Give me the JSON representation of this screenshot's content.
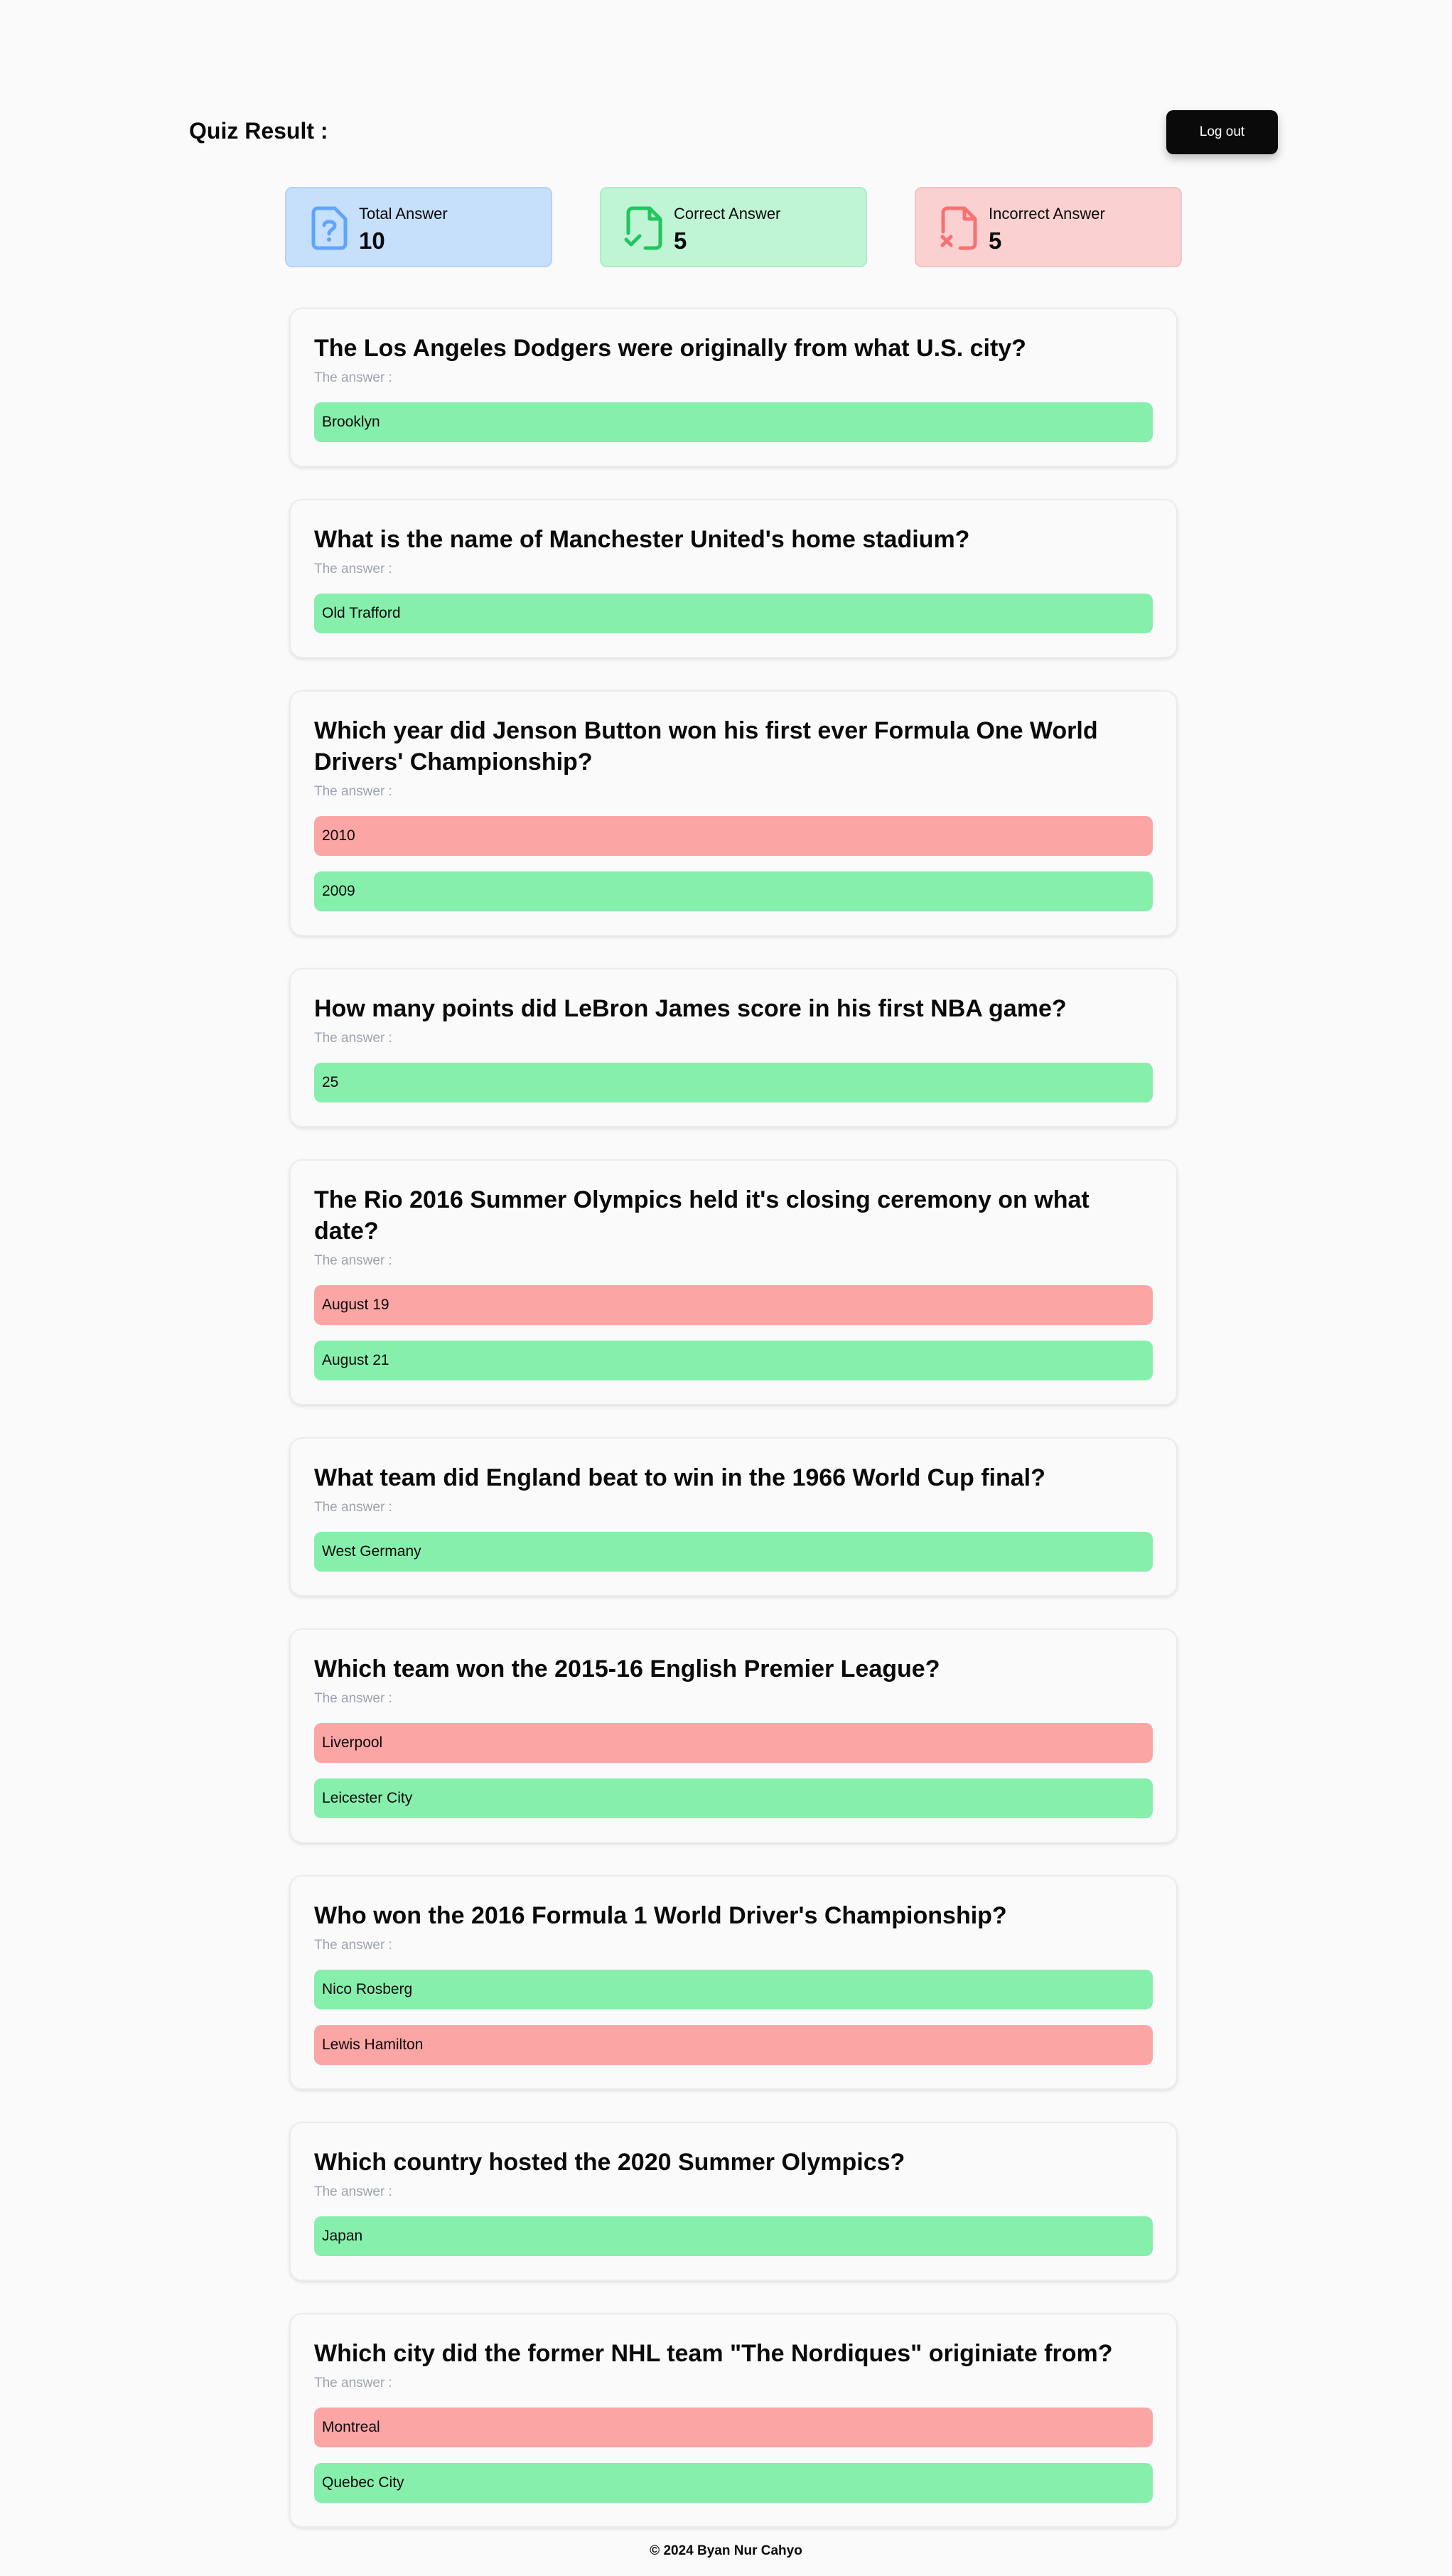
{
  "header": {
    "title": "Quiz Result :",
    "logout_label": "Log out"
  },
  "stats": [
    {
      "label": "Total Answer",
      "value": "10",
      "icon": "question-file-icon",
      "bg": "#c6dffb",
      "border": "#b4d2f6",
      "icon_color": "#60a5fa"
    },
    {
      "label": "Correct Answer",
      "value": "5",
      "icon": "check-file-icon",
      "bg": "#bff4d5",
      "border": "#aeebc7",
      "icon_color": "#22c55e"
    },
    {
      "label": "Incorrect Answer",
      "value": "5",
      "icon": "x-file-icon",
      "bg": "#fbd0d0",
      "border": "#f5c2c2",
      "icon_color": "#f87171"
    }
  ],
  "answer_caption": "The answer :",
  "colors": {
    "correct": "#86efac",
    "incorrect": "#fca5a5"
  },
  "questions": [
    {
      "question": "The Los Angeles Dodgers were originally from what U.S. city?",
      "answers": [
        {
          "text": "Brooklyn",
          "status": "correct"
        }
      ]
    },
    {
      "question": "What is the name of Manchester United's home stadium?",
      "answers": [
        {
          "text": "Old Trafford",
          "status": "correct"
        }
      ]
    },
    {
      "question": "Which year did Jenson Button won his first ever Formula One World Drivers' Championship?",
      "answers": [
        {
          "text": "2010",
          "status": "incorrect"
        },
        {
          "text": "2009",
          "status": "correct"
        }
      ]
    },
    {
      "question": "How many points did LeBron James score in his first NBA game?",
      "answers": [
        {
          "text": "25",
          "status": "correct"
        }
      ]
    },
    {
      "question": "The Rio 2016 Summer Olympics held it's closing ceremony on what date?",
      "answers": [
        {
          "text": "August 19",
          "status": "incorrect"
        },
        {
          "text": "August 21",
          "status": "correct"
        }
      ]
    },
    {
      "question": "What team did England beat to win in the 1966 World Cup final?",
      "answers": [
        {
          "text": "West Germany",
          "status": "correct"
        }
      ]
    },
    {
      "question": "Which team won the 2015-16 English Premier League?",
      "answers": [
        {
          "text": "Liverpool",
          "status": "incorrect"
        },
        {
          "text": "Leicester City",
          "status": "correct"
        }
      ]
    },
    {
      "question": "Who won the 2016 Formula 1 World Driver's Championship?",
      "answers": [
        {
          "text": "Nico Rosberg",
          "status": "correct"
        },
        {
          "text": "Lewis Hamilton",
          "status": "incorrect"
        }
      ]
    },
    {
      "question": "Which country hosted the 2020 Summer Olympics?",
      "answers": [
        {
          "text": "Japan",
          "status": "correct"
        }
      ]
    },
    {
      "question": "Which city did the former NHL team \"The Nordiques\" originiate from?",
      "answers": [
        {
          "text": "Montreal",
          "status": "incorrect"
        },
        {
          "text": "Quebec City",
          "status": "correct"
        }
      ]
    }
  ],
  "footer": {
    "text": "© 2024 Byan Nur Cahyo"
  }
}
